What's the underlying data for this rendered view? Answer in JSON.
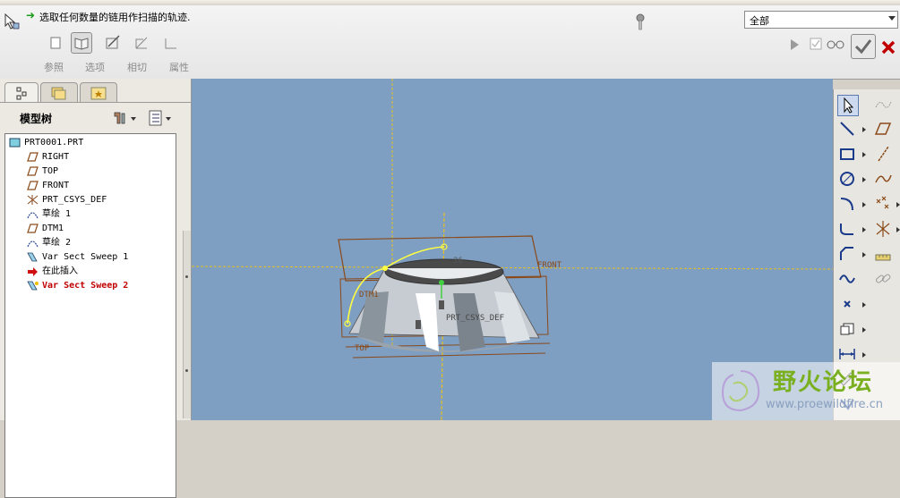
{
  "dashboard": {
    "prompt": "选取任何数量的链用作扫描的轨迹.",
    "tools": [
      {
        "label": "参照",
        "icon": "references-icon"
      },
      {
        "label": "选项",
        "icon": "options-icon"
      },
      {
        "label": "相切",
        "icon": "tangency-icon"
      },
      {
        "label": "属性",
        "icon": "properties-icon"
      }
    ],
    "filter_value": "全部"
  },
  "model_tree": {
    "title": "模型树",
    "nodes": [
      {
        "label": "PRT0001.PRT",
        "icon": "part-icon",
        "level": 0
      },
      {
        "label": "RIGHT",
        "icon": "datum-plane-icon",
        "level": 1
      },
      {
        "label": "TOP",
        "icon": "datum-plane-icon",
        "level": 1
      },
      {
        "label": "FRONT",
        "icon": "datum-plane-icon",
        "level": 1
      },
      {
        "label": "PRT_CSYS_DEF",
        "icon": "csys-icon",
        "level": 1
      },
      {
        "label": "草绘 1",
        "icon": "sketch-icon",
        "level": 1
      },
      {
        "label": "DTM1",
        "icon": "datum-plane-icon",
        "level": 1
      },
      {
        "label": "草绘 2",
        "icon": "sketch-icon",
        "level": 1
      },
      {
        "label": "Var Sect Sweep 1",
        "icon": "sweep-icon",
        "level": 1
      },
      {
        "label": "在此插入",
        "icon": "insert-here-icon",
        "level": 1
      },
      {
        "label": "Var Sect Sweep 2",
        "icon": "sweep-active-icon",
        "level": 1
      }
    ]
  },
  "viewport_labels": {
    "front": "FRONT",
    "top": "TOP",
    "dtm1": "DTM1",
    "csys": "PRT_CSYS_DEF",
    "dim": "36"
  },
  "watermark": {
    "title": "野火论坛",
    "url": "www.proewildfire.cn"
  },
  "colors": {
    "viewport_bg": "#7e9ec2",
    "datum_plane": "#8a4a1a",
    "axis_line": "#e0b020",
    "selected_text": "#c00000"
  }
}
